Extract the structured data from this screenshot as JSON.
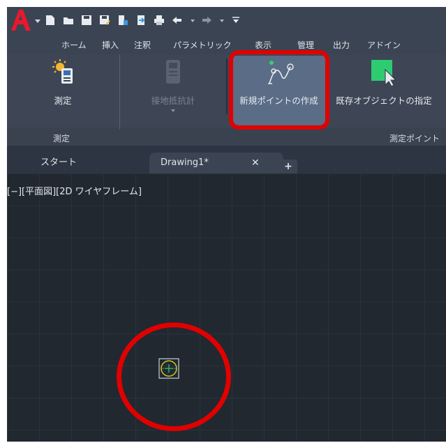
{
  "quick_access": {
    "icons": [
      "new-icon",
      "open-icon",
      "save-icon",
      "save-as-icon",
      "plot-icon",
      "import-icon",
      "print-icon",
      "undo-icon",
      "redo-icon",
      "customize-icon"
    ]
  },
  "ribbon_tabs": [
    "ホーム",
    "挿入",
    "注釈",
    "パラメトリック",
    "表示",
    "管理",
    "出力",
    "アドイン"
  ],
  "ribbon": {
    "measure_button": "測定",
    "ground_resistance_button": "接地抵抗計",
    "new_point_button": "新規ポイントの作成",
    "existing_object_button": "既存オブジェクトの指定",
    "panel_measure": "測定",
    "panel_measure_point": "測定ポイント"
  },
  "doc_tabs": {
    "start": "スタート",
    "drawing": "Drawing1*",
    "close_glyph": "✕",
    "add_glyph": "+"
  },
  "viewport": {
    "label": "[−][平面図][2D ワイヤフレーム]"
  },
  "colors": {
    "highlight": "#e10000",
    "marker": "#c9c928",
    "accent_green": "#2ecc71"
  }
}
